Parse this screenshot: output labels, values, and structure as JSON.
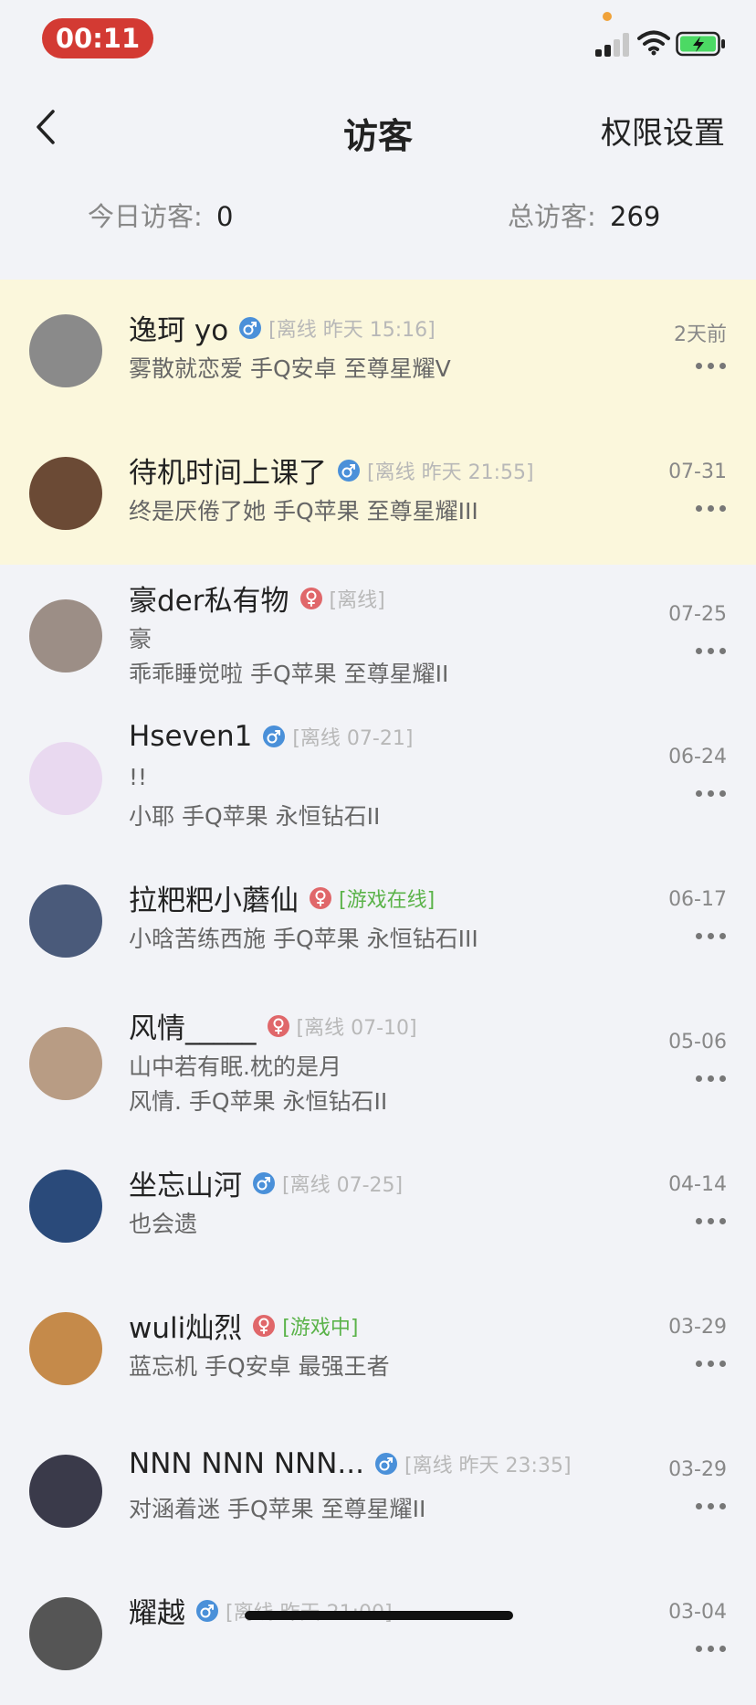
{
  "status_bar": {
    "time": "00:11"
  },
  "nav": {
    "title": "访客",
    "right_action": "权限设置"
  },
  "stats": {
    "today_label": "今日访客:",
    "today_value": "0",
    "total_label": "总访客:",
    "total_value": "269"
  },
  "visitors": [
    {
      "name": "逸珂 yo",
      "gender": "male",
      "status": "[离线 昨天 15:16]",
      "line2": "雾散就恋爱 手Q安卓 至尊星耀V",
      "line3": "",
      "date": "2天前",
      "highlight": true,
      "avatar_color": "#8a8a8a"
    },
    {
      "name": "待机时间上课了",
      "gender": "male",
      "status": "[离线 昨天 21:55]",
      "line2": "终是厌倦了她 手Q苹果 至尊星耀III",
      "line3": "",
      "date": "07-31",
      "highlight": true,
      "avatar_color": "#6b4a35"
    },
    {
      "name": "豪der私有物",
      "gender": "female",
      "status": "[离线]",
      "line2": "豪",
      "line3": "乖乖睡觉啦 手Q苹果 至尊星耀II",
      "date": "07-25",
      "highlight": false,
      "avatar_color": "#9c8e86"
    },
    {
      "name": "Hseven1",
      "gender": "male",
      "status": "[离线 07-21]",
      "line2": "!!",
      "line3": "小耶 手Q苹果 永恒钻石II",
      "date": "06-24",
      "highlight": false,
      "avatar_color": "#e9d9f0"
    },
    {
      "name": "拉粑粑小蘑仙",
      "gender": "female",
      "status": "[游戏在线]",
      "line2": "小晗苦练西施 手Q苹果 永恒钻石III",
      "line3": "",
      "date": "06-17",
      "highlight": false,
      "avatar_color": "#4a5a7a"
    },
    {
      "name": "风情_____",
      "gender": "female",
      "status": "[离线 07-10]",
      "line2": "山中若有眠.枕的是月",
      "line3": "  风情. 手Q苹果 永恒钻石II",
      "date": "05-06",
      "highlight": false,
      "avatar_color": "#b89c84"
    },
    {
      "name": "坐忘山河",
      "gender": "male",
      "status": "[离线 07-25]",
      "line2": "也会遗",
      "line3": "",
      "date": "04-14",
      "highlight": false,
      "avatar_color": "#2a4a7a"
    },
    {
      "name": "wuli灿烈",
      "gender": "female",
      "status": "[游戏中]",
      "line2": "蓝忘机 手Q安卓 最强王者",
      "line3": "",
      "date": "03-29",
      "highlight": false,
      "avatar_color": "#c58a4a"
    },
    {
      "name": "NNN NNN NNN...",
      "gender": "male",
      "status": "[离线 昨天 23:35]",
      "line2": "对涵着迷 手Q苹果 至尊星耀II",
      "line3": "",
      "date": "03-29",
      "highlight": false,
      "avatar_color": "#3a3a4a"
    },
    {
      "name": "耀越",
      "gender": "male",
      "status": "[离线 昨天 21:00]",
      "line2": "",
      "line3": "",
      "date": "03-04",
      "highlight": false,
      "avatar_color": "#555"
    }
  ],
  "colors": {
    "time_pill": "#d33a33",
    "highlight_bg": "#fbf7dc",
    "male": "#4a90d9",
    "female": "#e0676a",
    "online": "#5bb34a",
    "page_bg": "#f2f3f7"
  }
}
